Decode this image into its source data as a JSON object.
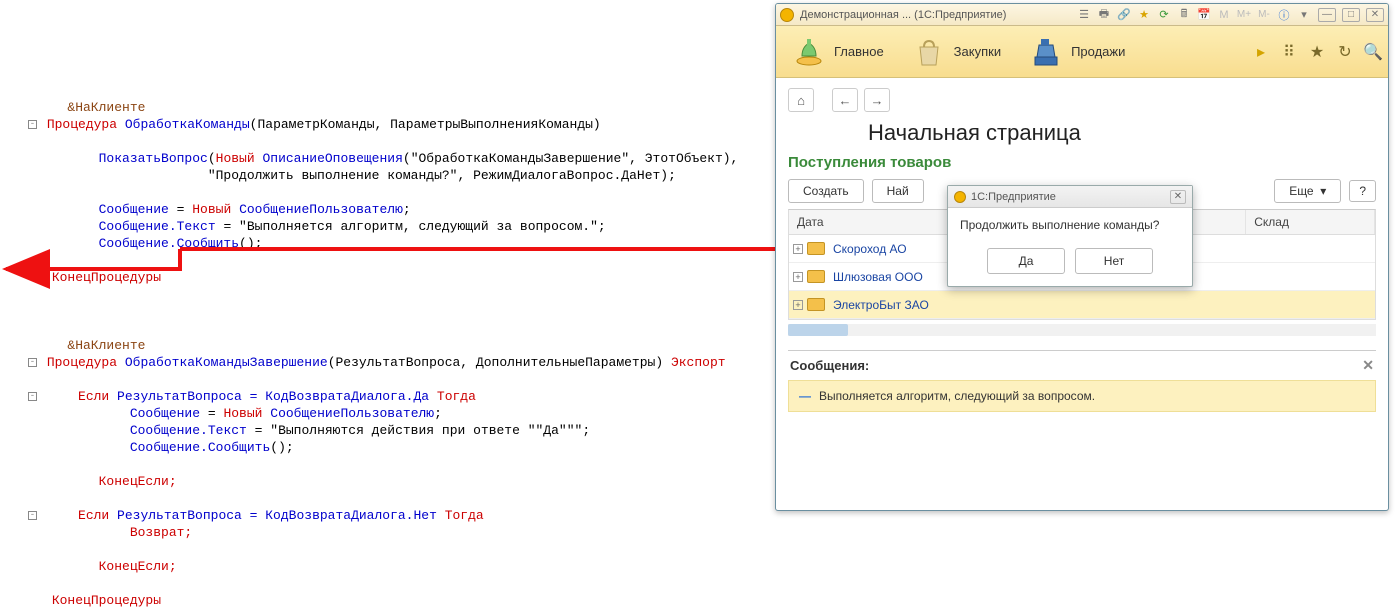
{
  "code": {
    "directive": "&НаКлиенте",
    "proc_kw": "Процедура",
    "proc1_name": "ОбработкаКоманды",
    "proc1_params": "(ПараметрКоманды, ПараметрыВыполненияКоманды)",
    "show_q": "ПоказатьВопрос",
    "new_kw": "Новый",
    "notif_desc": "ОписаниеОповещения",
    "show_q_args1": "(\"ОбработкаКомандыЗавершение\", ЭтотОбъект),",
    "show_q_args2": "\"Продолжить выполнение команды?\", РежимДиалогаВопрос.ДаНет);",
    "msg_var": "Сообщение",
    "eq": " = ",
    "user_msg": "СообщениеПользователю",
    "msg_text_prop": "Сообщение.Текст",
    "msg_text_val": " = \"Выполняется алгоритм, следующий за вопросом.\";",
    "msg_report": "Сообщение.Сообщить",
    "end_proc": "КонецПроцедуры",
    "proc2_name": "ОбработкаКомандыЗавершение",
    "proc2_params": "(РезультатВопроса, ДополнительныеПараметры)",
    "export_kw": " Экспорт",
    "if_kw": "Если",
    "then_kw": " Тогда",
    "cond_yes": " РезультатВопроса = КодВозвратаДиалога.Да",
    "cond_no": " РезультатВопроса = КодВозвратаДиалога.Нет",
    "msg_text_val2": " = \"Выполняются действия при ответе \"\"Да\"\"\";",
    "endif_kw": "КонецЕсли;",
    "return_kw": "Возврат;",
    "semicolon": ";",
    "empty_parens": "();"
  },
  "window": {
    "title": "Демонстрационная ...  (1С:Предприятие)",
    "ribbon": {
      "main": "Главное",
      "purchase": "Закупки",
      "sales": "Продажи"
    },
    "page_title": "Начальная страница",
    "section": "Поступления товаров",
    "buttons": {
      "create": "Создать",
      "find": "Най",
      "more": "Еще",
      "more_caret": "▾",
      "help": "?"
    },
    "grid": {
      "col_date": "Дата",
      "col_warehouse": "Склад",
      "rows": [
        "Скороход АО",
        "Шлюзовая ООО",
        "ЭлектроБыт ЗАО"
      ]
    },
    "messages": {
      "label": "Сообщения:",
      "text": "Выполняется алгоритм, следующий за вопросом."
    }
  },
  "dialog": {
    "title": "1С:Предприятие",
    "question": "Продолжить выполнение команды?",
    "yes": "Да",
    "no": "Нет"
  }
}
